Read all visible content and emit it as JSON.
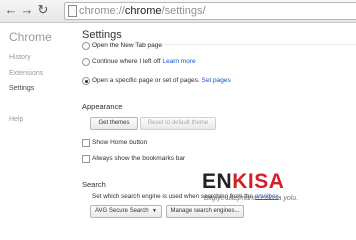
{
  "browser": {
    "url_prefix": "chrome://",
    "url_main": "chrome",
    "url_suffix": "/settings/"
  },
  "sidebar": {
    "brand": "Chrome",
    "items": [
      {
        "label": "History"
      },
      {
        "label": "Extensions"
      },
      {
        "label": "Settings"
      },
      {
        "label": "Help"
      }
    ]
  },
  "settings": {
    "title": "Settings",
    "startup": {
      "opt1": "Open the New Tab page",
      "opt2": "Continue where I left off",
      "opt2_link": "Learn more",
      "opt3": "Open a specific page or set of pages.",
      "opt3_link": "Set pages"
    },
    "appearance": {
      "heading": "Appearance",
      "get_themes": "Get themes",
      "reset_theme": "Reset to default theme",
      "home_button": "Show Home button",
      "bookmarks_bar": "Always show the bookmarks bar"
    },
    "search": {
      "heading": "Search",
      "desc": "Set which search engine is used when searching from the",
      "desc_link": "omnibox",
      "desc_end": ".",
      "engine": "AVG Secure Search",
      "manage": "Manage search engines..."
    }
  },
  "watermark": {
    "logo_part1": "EN",
    "logo_part2": "KISA",
    "slogan": "Bilgiye ulaşmanın enkısa yolu."
  }
}
